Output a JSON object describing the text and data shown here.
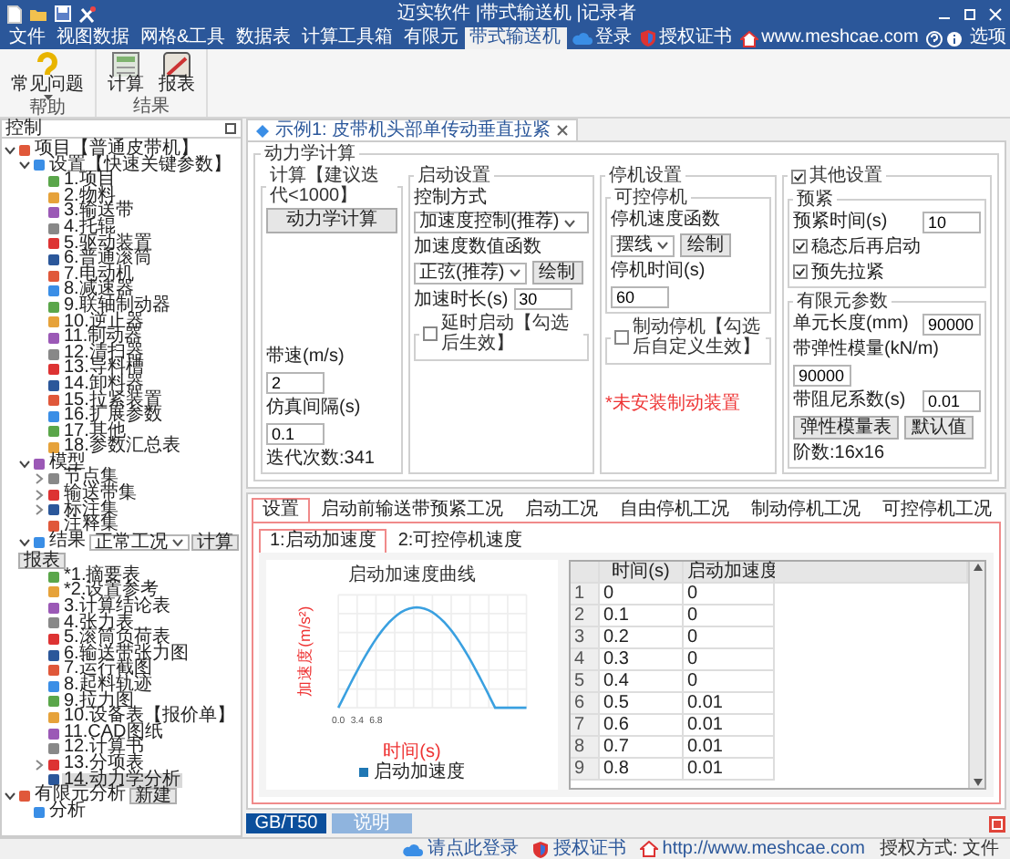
{
  "window": {
    "title": "迈实软件 |带式输送机 |记录者"
  },
  "menu_tabs": [
    {
      "label": "文件",
      "selected": false
    },
    {
      "label": "视图数据",
      "selected": false
    },
    {
      "label": "网格&工具",
      "selected": false
    },
    {
      "label": "数据表",
      "selected": false
    },
    {
      "label": "计算工具箱",
      "selected": false
    },
    {
      "label": "有限元",
      "selected": false
    },
    {
      "label": "带式输送机",
      "selected": true
    }
  ],
  "account_links": [
    {
      "label": "登录",
      "kind": "login"
    },
    {
      "label": "授权证书",
      "kind": "certificate"
    },
    {
      "label": "www.meshcae.com",
      "kind": "website"
    },
    {
      "label": "选项",
      "kind": "options"
    }
  ],
  "ribbon": {
    "groups": [
      {
        "label": "帮助",
        "buttons": [
          {
            "label": "常见问题",
            "kind": "help",
            "dropdown": true
          }
        ]
      },
      {
        "label": "结果",
        "buttons": [
          {
            "label": "计算",
            "kind": "calc",
            "dropdown": false
          },
          {
            "label": "报表",
            "kind": "report",
            "dropdown": false
          }
        ]
      }
    ]
  },
  "left_panel": {
    "title": "控制",
    "tree": [
      {
        "label": "项目【普通皮带机】",
        "expanded": true,
        "selected": false,
        "children": [
          {
            "label": "设置【快速关键参数】",
            "expanded": true,
            "selected": false,
            "children": [
              {
                "label": "1.项目",
                "selected": false
              },
              {
                "label": "2.物料",
                "selected": false
              },
              {
                "label": "3.输送带",
                "selected": false
              },
              {
                "label": "4.托辊",
                "selected": false
              },
              {
                "label": "5.驱动装置",
                "selected": false
              },
              {
                "label": "6.普通滚筒",
                "selected": false
              },
              {
                "label": "7.电动机",
                "selected": false
              },
              {
                "label": "8.减速器",
                "selected": false
              },
              {
                "label": "9.联轴制动器",
                "selected": false
              },
              {
                "label": "10.逆止器",
                "selected": false
              },
              {
                "label": "11.制动器",
                "selected": false
              },
              {
                "label": "12.清扫器",
                "selected": false
              },
              {
                "label": "13.导料槽",
                "selected": false
              },
              {
                "label": "14.卸料器",
                "selected": false
              },
              {
                "label": "15.拉紧装置",
                "selected": false
              },
              {
                "label": "16.扩展参数",
                "selected": false
              },
              {
                "label": "17.其他",
                "selected": false
              },
              {
                "label": "18.参数汇总表",
                "selected": false
              }
            ]
          },
          {
            "label": "模型",
            "expanded": true,
            "selected": false,
            "children": [
              {
                "label": "节点集",
                "expanded": false,
                "selected": false
              },
              {
                "label": "输送带集",
                "expanded": false,
                "selected": false
              },
              {
                "label": "标注集",
                "expanded": false,
                "selected": false
              },
              {
                "label": "注释集",
                "selected": false
              }
            ]
          },
          {
            "label": "结果",
            "expanded": true,
            "selected": false,
            "combo": "正常工况",
            "buttons": [
              "计算",
              "报表"
            ],
            "children": [
              {
                "label": "*1.摘要表",
                "selected": false
              },
              {
                "label": "*2.设置参考",
                "selected": false
              },
              {
                "label": "3.计算结论表",
                "selected": false
              },
              {
                "label": "4.张力表",
                "selected": false
              },
              {
                "label": "5.滚筒负荷表",
                "selected": false
              },
              {
                "label": "6.输送带张力图",
                "selected": false
              },
              {
                "label": "7.运行截图",
                "selected": false
              },
              {
                "label": "8.起料轨迹",
                "selected": false
              },
              {
                "label": "9.拉力图",
                "selected": false
              },
              {
                "label": "10.设备表【报价单】",
                "selected": false
              },
              {
                "label": "11.CAD图纸",
                "selected": false
              },
              {
                "label": "12.计算书",
                "selected": false
              },
              {
                "label": "13.分项表",
                "expanded": false,
                "selected": false
              },
              {
                "label": "14.动力学分析",
                "selected": true
              }
            ]
          }
        ]
      },
      {
        "label": "有限元分析",
        "expanded": true,
        "selected": false,
        "buttons": [
          "新建"
        ],
        "children": [
          {
            "label": "分析",
            "selected": false
          }
        ]
      }
    ]
  },
  "document_tab": {
    "label": "示例1: 皮带机头部单传动垂直拉紧"
  },
  "dynamics": {
    "title": "动力学计算",
    "calc": {
      "title": "计算【建议迭代<1000】",
      "button": "动力学计算",
      "fields": [
        {
          "label": "带速(m/s)",
          "value": "2"
        },
        {
          "label": "仿真间隔(s)",
          "value": "0.1"
        }
      ],
      "iterations": "迭代次数:341"
    },
    "start": {
      "title": "启动设置",
      "control_mode": {
        "label": "控制方式",
        "value": "加速度控制(推荐)"
      },
      "function": {
        "label": "加速度数值函数",
        "value": "正弦(推荐)",
        "button": "绘制"
      },
      "duration": {
        "label": "加速时长(s)",
        "value": "30"
      },
      "delay": {
        "label": "延时启动【勾选后生效】",
        "checked": false
      }
    },
    "stop": {
      "title": "停机设置",
      "controlled": {
        "title": "可控停机",
        "function": {
          "label": "停机速度函数",
          "value": "摆线",
          "button": "绘制"
        },
        "time": {
          "label": "停机时间(s)",
          "value": "60"
        }
      },
      "brake": {
        "label": "制动停机【勾选后自定义生效】",
        "checked": false
      },
      "warning": "*未安装制动装置"
    },
    "other": {
      "label": "其他设置",
      "checked": true,
      "pretension": {
        "title": "预紧",
        "time": {
          "label": "预紧时间(s)",
          "value": "10"
        },
        "options": [
          {
            "label": "稳态后再启动",
            "checked": true
          },
          {
            "label": "预先拉紧",
            "checked": true
          }
        ]
      },
      "fem": {
        "title": "有限元参数",
        "fields": [
          {
            "label": "单元长度(mm)",
            "value": "90000"
          },
          {
            "label": "带弹性模量(kN/m)",
            "value": "90000"
          },
          {
            "label": "带阻尼系数(s)",
            "value": "0.01"
          }
        ],
        "buttons": [
          "弹性模量表",
          "默认值"
        ],
        "mesh": "阶数:16x16"
      }
    }
  },
  "result_tabs": [
    {
      "label": "设置",
      "selected": true
    },
    {
      "label": "启动前输送带预紧工况",
      "selected": false
    },
    {
      "label": "启动工况",
      "selected": false
    },
    {
      "label": "自由停机工况",
      "selected": false
    },
    {
      "label": "制动停机工况",
      "selected": false
    },
    {
      "label": "可控停机工况",
      "selected": false
    }
  ],
  "sub_tabs": [
    {
      "label": "1:启动加速度",
      "selected": true
    },
    {
      "label": "2:可控停机速度",
      "selected": false
    }
  ],
  "chart": {
    "title": "启动加速度曲线",
    "ylabel": "加速度(m/s²)",
    "xlabel": "时间(s)",
    "x_tick_labels": [
      "0.0",
      "3.4",
      "6.8"
    ],
    "legend": "启动加速度"
  },
  "table": {
    "columns": [
      "时间(s)",
      "启动加速度"
    ],
    "rows": [
      {
        "index": "1",
        "cells": [
          "0",
          "0"
        ]
      },
      {
        "index": "2",
        "cells": [
          "0.1",
          "0"
        ]
      },
      {
        "index": "3",
        "cells": [
          "0.2",
          "0"
        ]
      },
      {
        "index": "4",
        "cells": [
          "0.3",
          "0"
        ]
      },
      {
        "index": "5",
        "cells": [
          "0.4",
          "0"
        ]
      },
      {
        "index": "6",
        "cells": [
          "0.5",
          "0.01"
        ]
      },
      {
        "index": "7",
        "cells": [
          "0.6",
          "0.01"
        ]
      },
      {
        "index": "8",
        "cells": [
          "0.7",
          "0.01"
        ]
      },
      {
        "index": "9",
        "cells": [
          "0.8",
          "0.01"
        ]
      }
    ]
  },
  "bottom_buttons": [
    {
      "label": "GB/T50",
      "selected": true
    },
    {
      "label": "说明",
      "selected": false
    }
  ],
  "status_bar": {
    "links": [
      {
        "label": "请点此登录",
        "kind": "login"
      },
      {
        "label": "授权证书",
        "kind": "certificate"
      },
      {
        "label": "http://www.meshcae.com",
        "kind": "website"
      }
    ],
    "license": "授权方式: 文件"
  }
}
